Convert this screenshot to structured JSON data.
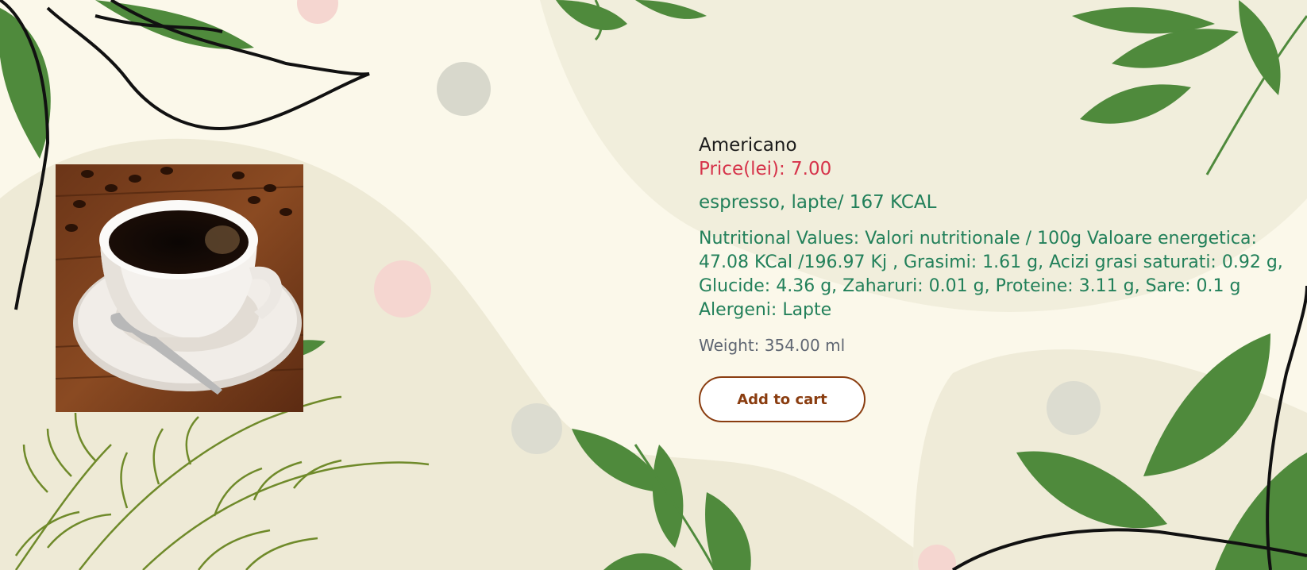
{
  "product": {
    "name": "Americano",
    "price_label": "Price(lei): 7.00",
    "description": "espresso, lapte/ 167 KCAL",
    "nutrition": "Nutritional Values: Valori nutritionale / 100g Valoare energetica: 47.08 KCal /196.97 Kj , Grasimi: 1.61 g, Acizi grasi saturati: 0.92 g, Glucide: 4.36 g, Zaharuri: 0.01 g, Proteine: 3.11 g, Sare: 0.1 g Alergeni: Lapte",
    "weight_label": "Weight: 354.00 ml",
    "add_to_cart_label": "Add to cart",
    "image_icon": "coffee-cup-image"
  },
  "colors": {
    "name": "#1b1b1b",
    "price": "#d6334a",
    "green_text": "#22805a",
    "weight": "#5f6672",
    "button_accent": "#8a3d10",
    "background": "#fbf8ea",
    "leaf_green": "#4f8a3c"
  }
}
